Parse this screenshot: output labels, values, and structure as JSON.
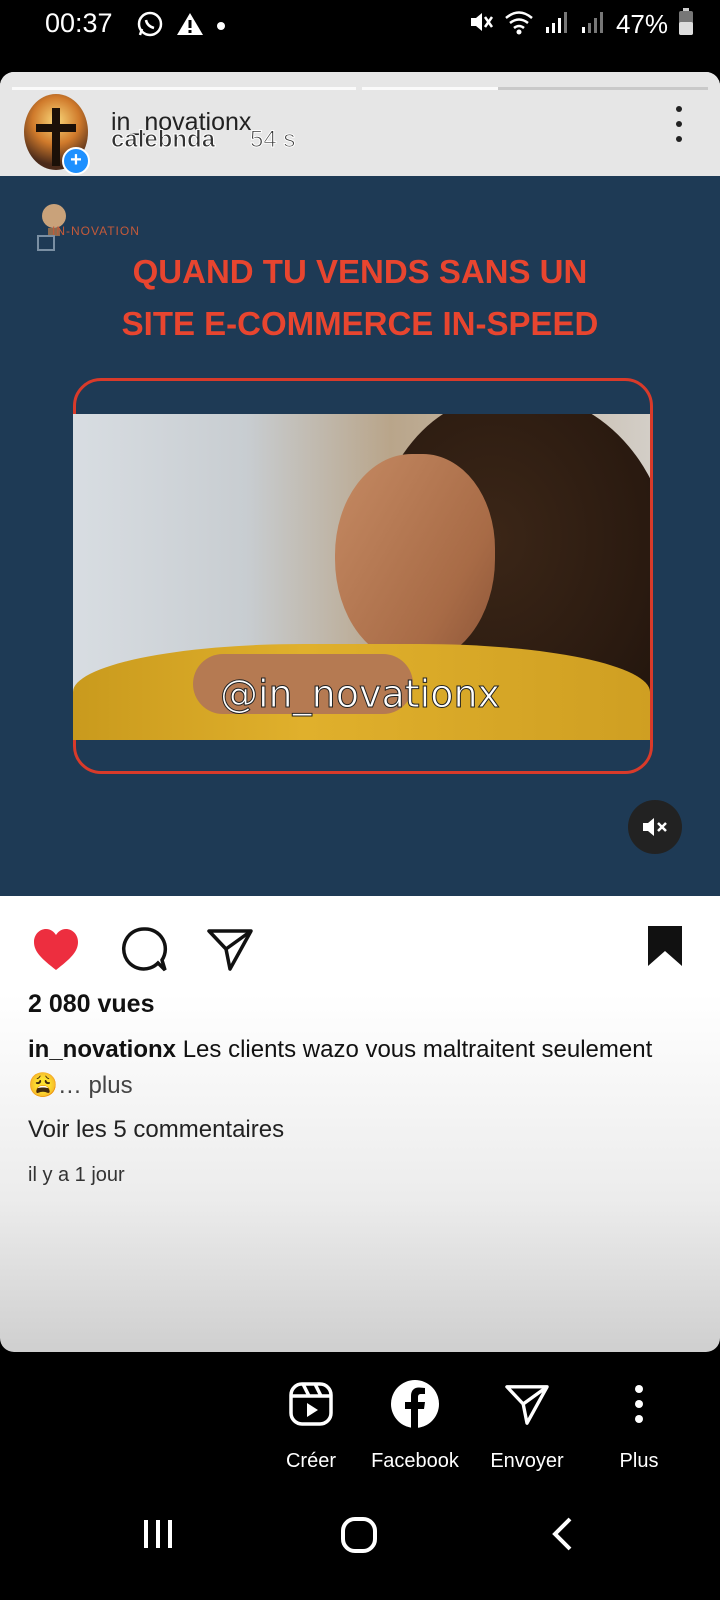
{
  "status_bar": {
    "time": "00:37",
    "battery": "47%",
    "left_icons": [
      "whatsapp-icon",
      "warning-icon",
      "dot-icon"
    ],
    "right_icons": [
      "mute-icon",
      "wifi-icon",
      "signal-icon",
      "signal-icon",
      "battery-icon"
    ]
  },
  "story": {
    "username": "in_novationx",
    "overlay_username": "calebnda",
    "elapsed": "54 s",
    "brand_text": "IN-NOVATION",
    "headline_line1": "QUAND TU VENDS SANS UN",
    "headline_line2": "SITE E-COMMERCE IN-SPEED",
    "watermark": "@in_novationx"
  },
  "post": {
    "views": "2 080 vues",
    "caption_user": "in_novationx",
    "caption_text": "Les clients wazo vous maltraitent seulement😩",
    "caption_more": "… plus",
    "comments_link": "Voir les 5 commentaires",
    "time_ago": "il y a 1 jour"
  },
  "share": {
    "create": "Créer",
    "facebook": "Facebook",
    "send": "Envoyer",
    "more": "Plus"
  },
  "colors": {
    "media_bg": "#1e3a55",
    "headline": "#e8452f",
    "like": "#ed2e3f"
  }
}
